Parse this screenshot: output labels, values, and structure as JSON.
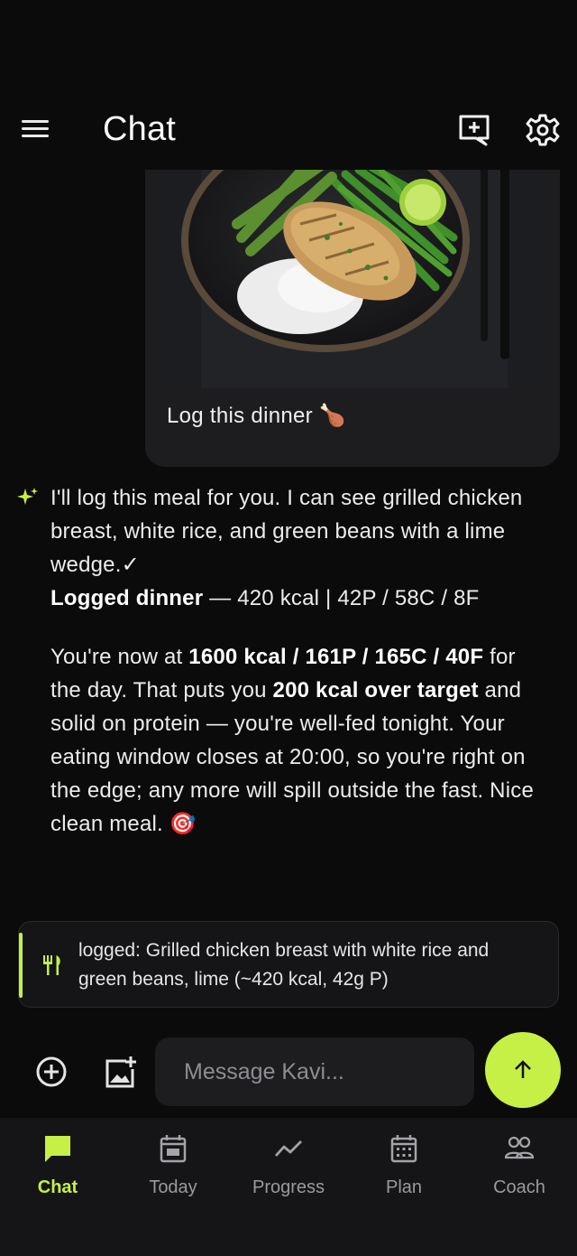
{
  "header": {
    "title": "Chat",
    "menu_icon": "menu-icon",
    "new_chat_icon": "new-chat-icon",
    "settings_icon": "gear-icon"
  },
  "chat": {
    "user_message": {
      "image": "grilled-chicken-plate-photo",
      "text": "Log this dinner 🍗"
    },
    "assistant_message": {
      "icon": "sparkle-icon",
      "intro": "I'll log this meal for you. I can see grilled chicken breast, white rice, and green beans with a lime wedge.✓",
      "logged_label": "Logged dinner",
      "logged_detail": " — 420 kcal | 42P / 58C / 8F",
      "p2_a": "You're now at ",
      "p2_b": "1600 kcal / 161P / 165C / 40F",
      "p2_c": " for the day. That puts you ",
      "p2_d": "200 kcal over target",
      "p2_e": " and solid on protein — you're well-fed tonight. Your eating window closes at 20:00, so you're right on the edge; any more will spill outside the fast. Nice clean meal. 🎯"
    },
    "log_card": {
      "icon": "fork-knife-icon",
      "text": "logged: Grilled chicken breast with white rice and green beans, lime (~420 kcal, 42g P)"
    }
  },
  "composer": {
    "placeholder": "Message Kavi...",
    "value": "",
    "add_icon": "plus-circle-icon",
    "image_icon": "add-image-icon",
    "send_icon": "arrow-up-icon"
  },
  "nav": {
    "items": [
      {
        "label": "Chat",
        "icon": "chat-icon",
        "active": true
      },
      {
        "label": "Today",
        "icon": "calendar-day-icon",
        "active": false
      },
      {
        "label": "Progress",
        "icon": "trend-icon",
        "active": false
      },
      {
        "label": "Plan",
        "icon": "calendar-grid-icon",
        "active": false
      },
      {
        "label": "Coach",
        "icon": "people-icon",
        "active": false
      }
    ]
  },
  "colors": {
    "background": "#0b0b0c",
    "surface": "#1d1d20",
    "accent": "#c6f045",
    "nav_bg": "#151517",
    "muted": "#9a9a9f"
  }
}
